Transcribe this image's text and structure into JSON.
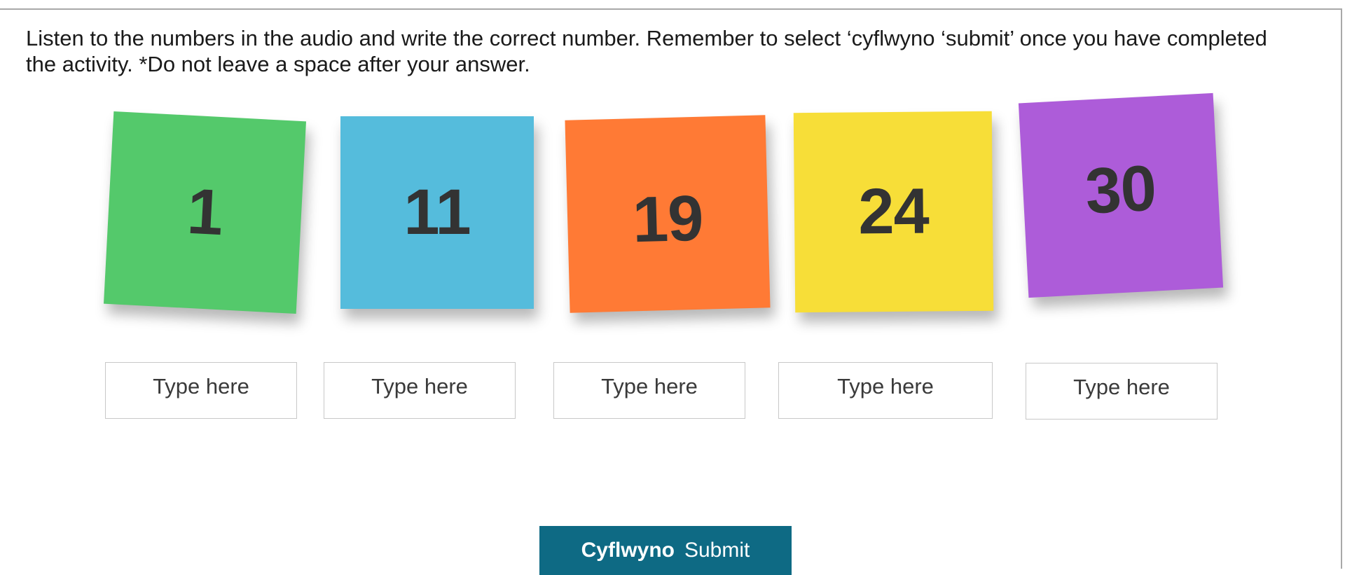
{
  "instructions": "Listen to the numbers in the audio and write the correct number. Remember to select ‘cyflwyno ‘submit’ once you have completed the activity. *Do not leave a space after your answer.",
  "notes": [
    {
      "number": "1",
      "color": "#54c96b"
    },
    {
      "number": "11",
      "color": "#55bcdc"
    },
    {
      "number": "19",
      "color": "#ff7a35"
    },
    {
      "number": "24",
      "color": "#f7de38"
    },
    {
      "number": "30",
      "color": "#ad5cd9"
    }
  ],
  "answers": [
    {
      "placeholder": "Type here",
      "value": ""
    },
    {
      "placeholder": "Type here",
      "value": ""
    },
    {
      "placeholder": "Type here",
      "value": ""
    },
    {
      "placeholder": "Type here",
      "value": ""
    },
    {
      "placeholder": "Type here",
      "value": ""
    }
  ],
  "submit": {
    "welsh_label": "Cyflwyno",
    "english_label": "Submit",
    "color": "#0e6a84"
  }
}
